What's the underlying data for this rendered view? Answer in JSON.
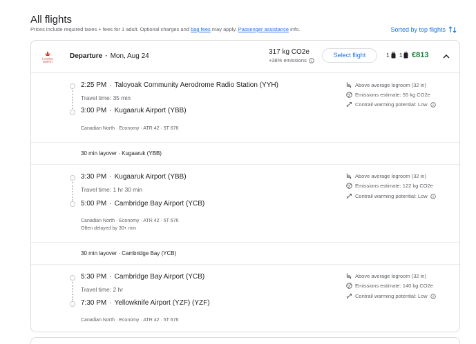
{
  "page": {
    "title": "All flights",
    "subtitle_prefix": "Prices include required taxes + fees for 1 adult. Optional charges and ",
    "bag_fees_link": "bag fees",
    "subtitle_middle": " may apply. ",
    "passenger_link": "Passenger assistance",
    "subtitle_suffix": " info.",
    "sort_label": "Sorted by top flights"
  },
  "flight": {
    "airline_logo_text": "Canadian North",
    "departure_label": "Departure",
    "separator": "·",
    "date": "Mon, Aug 24",
    "co2": "317 kg CO2e",
    "emissions_delta": "+38% emissions",
    "select_label": "Select flight",
    "carry_on": "1",
    "checked": "1",
    "price": "€813"
  },
  "segments": [
    {
      "depart_time": "2:25 PM",
      "depart_airport": "Taloyoak Community Aerodrome Radio Station (YYH)",
      "travel_time": "Travel time: 35 min",
      "arrive_time": "3:00 PM",
      "arrive_airport": "Kugaaruk Airport (YBB)",
      "details": "Canadian North · Economy · ATR 42 · 5T 676",
      "delay_note": "",
      "legroom": "Above average legroom (32 in)",
      "emissions": "Emissions estimate: 55 kg CO2e",
      "contrail": "Contrail warming potential: Low"
    },
    {
      "depart_time": "3:30 PM",
      "depart_airport": "Kugaaruk Airport (YBB)",
      "travel_time": "Travel time: 1 hr 30 min",
      "arrive_time": "5:00 PM",
      "arrive_airport": "Cambridge Bay Airport (YCB)",
      "details": "Canadian North · Economy · ATR 42 · 5T 676",
      "delay_note": "Often delayed by 30+ min",
      "legroom": "Above average legroom (32 in)",
      "emissions": "Emissions estimate: 122 kg CO2e",
      "contrail": "Contrail warming potential: Low"
    },
    {
      "depart_time": "5:30 PM",
      "depart_airport": "Cambridge Bay Airport (YCB)",
      "travel_time": "Travel time: 2 hr",
      "arrive_time": "7:30 PM",
      "arrive_airport": "Yellowknife Airport (YZF) (YZF)",
      "details": "Canadian North · Economy · ATR 42 · 5T 676",
      "delay_note": "",
      "legroom": "Above average legroom (32 in)",
      "emissions": "Emissions estimate: 140 kg CO2e",
      "contrail": "Contrail warming potential: Low"
    }
  ],
  "layovers": [
    "30 min layover · Kugaaruk (YBB)",
    "30 min layover · Cambridge Bay (YCB)"
  ],
  "colors": {
    "accent": "#1a73e8",
    "price": "#188038",
    "logo": "#d52b1e"
  }
}
